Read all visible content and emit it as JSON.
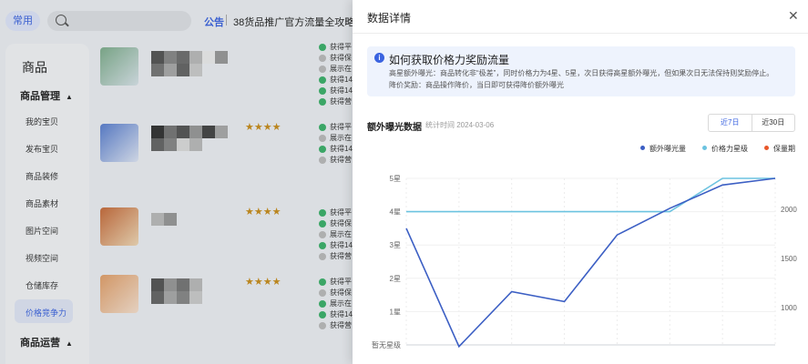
{
  "topbar": {
    "common_label": "常用",
    "notice_tag": "公告",
    "notice_text": "38货品推广官方流量全攻略"
  },
  "sidebar": {
    "title": "商品",
    "group1": "商品管理",
    "items": [
      "我的宝贝",
      "发布宝贝",
      "商品装修",
      "商品素材",
      "图片空间",
      "视频空间",
      "仓储库存",
      "价格竞争力"
    ],
    "group2": "商品运营"
  },
  "list": {
    "stars": "★★★★",
    "checks": [
      "获得平",
      "获得保",
      "展示在",
      "获得14",
      "获得营"
    ]
  },
  "drawer": {
    "title": "数据详情",
    "close_icon": "close-icon",
    "info": {
      "title": "如何获取价格力奖励流量",
      "line1": "高星额外曝光：商品转化非“极差”，同时价格力为4星、5星，次日获得高星额外曝光，但如果次日无法保持则奖励停止。",
      "line2": "降价奖励：商品操作降价，当日即可获得降价额外曝光"
    },
    "section_title": "额外曝光数据",
    "section_time": "统计时间 2024-03-06",
    "range": [
      "近7日",
      "近30日"
    ],
    "legend": [
      {
        "name": "额外曝光量",
        "color": "#3c5fc4"
      },
      {
        "name": "价格力星级",
        "color": "#6cc3e0"
      },
      {
        "name": "保量期",
        "color": "#e8572a"
      }
    ]
  },
  "chart_data": {
    "type": "line",
    "y_left_ticks": [
      "暂无星级",
      "1星",
      "2星",
      "3星",
      "4星",
      "5星"
    ],
    "y_right_ticks": [
      "1000",
      "1500",
      "2000"
    ],
    "x_count": 8,
    "series": [
      {
        "name": "额外曝光量",
        "unit": "星级轴",
        "values": [
          3.5,
          -0.05,
          1.6,
          1.3,
          3.3,
          4.1,
          4.8,
          5.0
        ]
      },
      {
        "name": "价格力星级",
        "unit": "星级",
        "values": [
          4,
          4,
          4,
          4,
          4,
          4,
          5,
          5
        ]
      }
    ],
    "ylim": [
      0,
      5
    ]
  }
}
